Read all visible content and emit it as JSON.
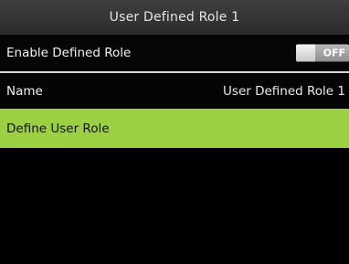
{
  "header": {
    "title": "User Defined Role 1"
  },
  "settings": {
    "enable_label": "Enable Defined Role",
    "enable_toggle": {
      "state": "OFF",
      "on": false
    },
    "name_label": "Name",
    "name_value": "User Defined Role 1",
    "define_role_label": "Define User Role"
  },
  "colors": {
    "background": "#000000",
    "header_bg": "#333333",
    "highlight": "#9bd043",
    "divider": "#d9d9d9",
    "toggle_off": "#a0a0a0"
  }
}
